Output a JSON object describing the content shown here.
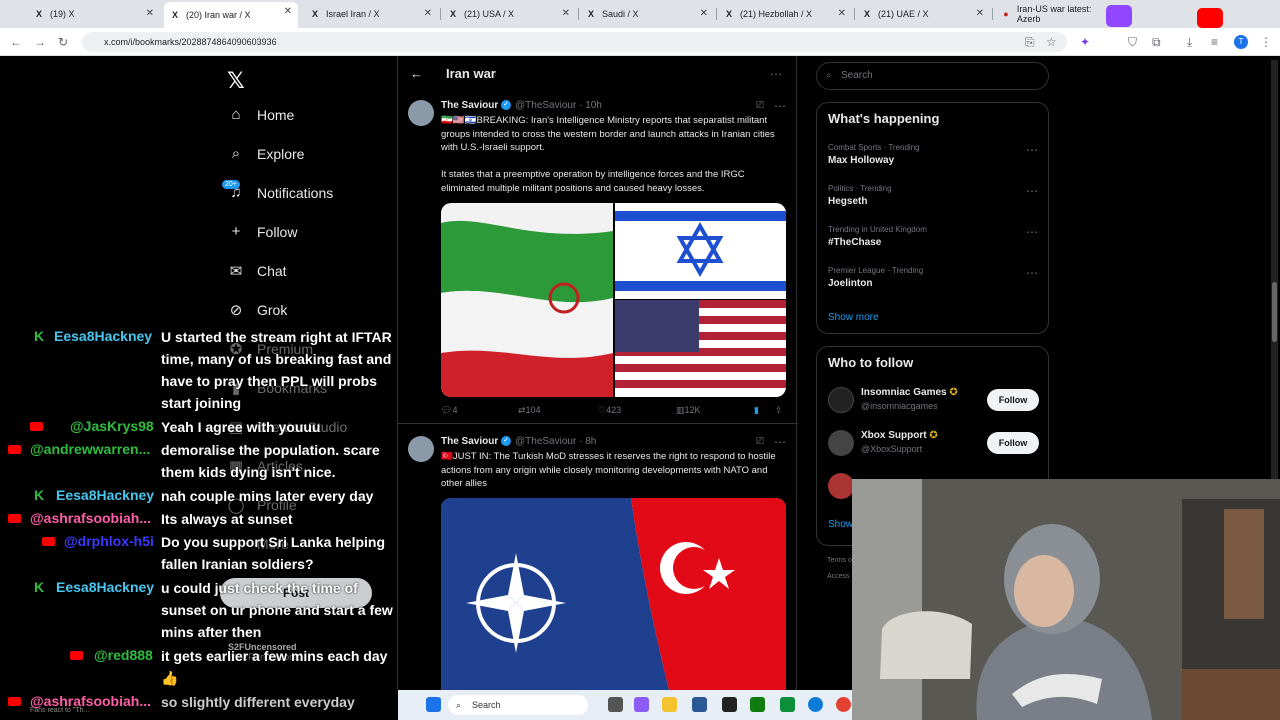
{
  "browser": {
    "tabs": [
      {
        "label": "(19) X",
        "fav": "X"
      },
      {
        "label": "(20) Iran war / X",
        "fav": "X"
      },
      {
        "label": "Israel Iran / X",
        "fav": "X"
      },
      {
        "label": "(21) USA / X",
        "fav": "X"
      },
      {
        "label": "Saudi / X",
        "fav": "X"
      },
      {
        "label": "(21) Hezbollah / X",
        "fav": "X"
      },
      {
        "label": "(21) UAE / X",
        "fav": "X"
      },
      {
        "label": "Iran-US war latest: Azerb",
        "fav": "●"
      }
    ],
    "url": "x.com/i/bookmarks/2028874864090603936"
  },
  "left_nav": {
    "items": [
      {
        "label": "Home",
        "icon": "⌂"
      },
      {
        "label": "Explore",
        "icon": "⌕"
      },
      {
        "label": "Notifications",
        "icon": "♫"
      },
      {
        "label": "Follow",
        "icon": "+"
      },
      {
        "label": "Chat",
        "icon": "✉"
      },
      {
        "label": "Grok",
        "icon": "⊘"
      },
      {
        "label": "Premium",
        "icon": "✪"
      },
      {
        "label": "Bookmarks",
        "icon": "▮"
      },
      {
        "label": "Creator Studio",
        "icon": "▤"
      },
      {
        "label": "Articles",
        "icon": "▦"
      },
      {
        "label": "Profile",
        "icon": "◯"
      },
      {
        "label": "More",
        "icon": "⋯"
      }
    ],
    "notif_badge": "20+",
    "post_label": "Post",
    "profile_name": "S2FUncensored",
    "profile_handle": "@S2FUncensored"
  },
  "chat": [
    {
      "user": "Eesa8Hackney",
      "type": "k",
      "color": "#48c6ef",
      "msg": "U started the stream right at IFTAR time, many of us breaking fast and have to pray then PPL will probs start joining"
    },
    {
      "user": "@JasKrys98",
      "type": "yt",
      "color": "#2dbe3c",
      "msg": "Yeah I agree with youuu"
    },
    {
      "user": "@andrewwarren...",
      "type": "yt",
      "color": "#2dbe3c",
      "msg": "demoralise the population. scare them kids dying isn't nice."
    },
    {
      "user": "Eesa8Hackney",
      "type": "k",
      "color": "#48c6ef",
      "msg": "nah couple mins later every day"
    },
    {
      "user": "@ashrafsoobiah...",
      "type": "yt",
      "color": "#ff5ea8",
      "msg": "Its always at sunset"
    },
    {
      "user": "@drphlox-h5i",
      "type": "yt",
      "color": "#3b3bff",
      "msg": "Do you support Sri Lanka helping fallen Iranian soldiers?"
    },
    {
      "user": "Eesa8Hackney",
      "type": "k",
      "color": "#48c6ef",
      "msg": "u could just check the time of sunset on ur phone and start a few mins after then"
    },
    {
      "user": "@red888",
      "type": "yt",
      "color": "#2dbe3c",
      "msg": "it gets earlier a few mins each day 👍"
    },
    {
      "user": "@ashrafsoobiah...",
      "type": "yt",
      "color": "#ff5ea8",
      "msg": "so slightly different everyday"
    }
  ],
  "chat_extra": "Fans react to \"Th...",
  "timeline": {
    "title": "Iran war",
    "tweets": [
      {
        "name": "The Saviour",
        "handle": "@TheSaviour",
        "time": "10h",
        "text1": "🇮🇷🇺🇸🇮🇱BREAKING: Iran's Intelligence Ministry reports that separatist militant groups intended to cross the western border and launch attacks in Iranian cities with U.S.-Israeli support.",
        "text2": "It states that a preemptive operation by intelligence forces and the IRGC eliminated multiple militant positions and caused heavy losses.",
        "replies": "4",
        "reposts": "104",
        "likes": "423",
        "views": "12K"
      },
      {
        "name": "The Saviour",
        "handle": "@TheSaviour",
        "time": "8h",
        "text1": "🇹🇷JUST IN: The Turkish MoD stresses it reserves the right to respond to hostile actions from any origin while closely monitoring developments with NATO and other allies",
        "text2": ""
      }
    ]
  },
  "right": {
    "search_placeholder": "Search",
    "happening_title": "What's happening",
    "trends": [
      {
        "ctx": "Combat Sports · Trending",
        "name": "Max Holloway"
      },
      {
        "ctx": "Politics · Trending",
        "name": "Hegseth"
      },
      {
        "ctx": "Trending in United Kingdom",
        "name": "#TheChase"
      },
      {
        "ctx": "Premier League · Trending",
        "name": "Joelinton"
      }
    ],
    "show_more": "Show more",
    "wtf_title": "Who to follow",
    "wtf": [
      {
        "name": "Insomniac Games",
        "handle": "@insomniacgames",
        "av": "#222"
      },
      {
        "name": "Xbox Support",
        "handle": "@XboxSupport",
        "av": "#444"
      }
    ],
    "follow_label": "Follow",
    "show_partial": "Show",
    "footer1": "Terms o",
    "footer2": "Access"
  },
  "taskbar": {
    "search": "Search"
  },
  "colors": {
    "accent": "#1d9bf0",
    "bg": "#000000"
  }
}
